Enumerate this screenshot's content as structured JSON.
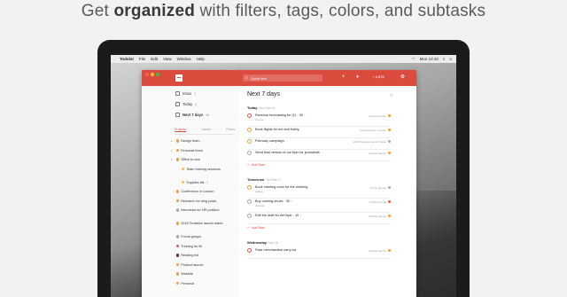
{
  "headline": {
    "pre": "Get ",
    "bold": "organized",
    "post": " with filters, tags, colors, and subtasks"
  },
  "menubar": {
    "app": "Todoist",
    "items": [
      "File",
      "Edit",
      "View",
      "Window",
      "Help"
    ],
    "clock": "Mon 13:10"
  },
  "toolbar": {
    "search_placeholder": "Quick find",
    "karma": "4,876"
  },
  "sidebar": {
    "nav": [
      {
        "label": "Inbox",
        "count": "5"
      },
      {
        "label": "Today",
        "count": "6"
      },
      {
        "label": "Next 7 days",
        "count": "26"
      }
    ],
    "tabs": [
      "Projects",
      "Labels",
      "Filters"
    ],
    "projects": [
      {
        "label": "Design team",
        "count": "",
        "color": "#f0a030",
        "caret": "▸",
        "indent": 0
      },
      {
        "label": "Financial team",
        "count": "",
        "color": "#f0a030",
        "caret": "▸",
        "indent": 0
      },
      {
        "label": "Office to-dos",
        "count": "",
        "color": "#f0a030",
        "caret": "▾",
        "indent": 0
      },
      {
        "label": "Team training sessions",
        "count": "",
        "color": "#f5c242",
        "caret": "",
        "indent": 1
      },
      {
        "label": "Supplies list",
        "count": "5",
        "color": "#f5c242",
        "caret": "",
        "indent": 1
      },
      {
        "label": "Conference in London",
        "count": "",
        "color": "#f0a030",
        "caret": "",
        "indent": 0
      },
      {
        "label": "Research for blog posts",
        "count": "",
        "color": "#f0a030",
        "caret": "",
        "indent": 0
      },
      {
        "label": "Interviews for HR position",
        "count": "",
        "color": "#aaaaaa",
        "caret": "",
        "indent": 0
      },
      {
        "label": "2016 Tentative launch dates",
        "count": "",
        "color": "#f0a030",
        "caret": "",
        "indent": 0
      },
      {
        "label": "Focus groups",
        "count": "",
        "color": "#aaaaaa",
        "caret": "",
        "indent": 0
      },
      {
        "label": "Training for 5k",
        "count": "",
        "color": "#e05a4f",
        "caret": "",
        "indent": 0
      },
      {
        "label": "Reading list",
        "count": "",
        "color": "#8a2a2a",
        "caret": "",
        "indent": 0
      },
      {
        "label": "Product launch",
        "count": "",
        "color": "#f0a030",
        "caret": "",
        "indent": 0
      },
      {
        "label": "Website",
        "count": "",
        "color": "#f0a030",
        "caret": "",
        "indent": 0
      },
      {
        "label": "Personal",
        "count": "",
        "color": "#f0a030",
        "caret": "",
        "indent": 0
      }
    ]
  },
  "main": {
    "title": "Next 7 days",
    "add_task": "Add Task",
    "sections": [
      {
        "name": "Today",
        "sub": "Mon Mar 16",
        "tasks": [
          {
            "text": "Revenue forecasting for Q1 · 30 ◦",
            "label": "finance",
            "project": "Financial team",
            "color": "#f0a030",
            "cb": "#e05a4f"
          },
          {
            "text": "Book flights for me and Kathy",
            "label": "",
            "project": "Conference in London",
            "color": "#f0a030",
            "cb": "#f0a030"
          },
          {
            "text": "February campaign",
            "label": "",
            "project": "2016 Tentative launch dates",
            "color": "#aaaaaa",
            "cb": "#f0a030"
          },
          {
            "text": "Send final version of our flyer for journalists",
            "label": "",
            "project": "Product launch",
            "color": "#f0a030",
            "cb": "#aaaaaa"
          }
        ]
      },
      {
        "name": "Tomorrow",
        "sub": "Tue Mar 17",
        "tasks": [
          {
            "text": "Book meeting room for the meeting",
            "label": "calling",
            "project": "Focus groups",
            "color": "#aaaaaa",
            "cb": "#f0a030"
          },
          {
            "text": "Buy running shoes · 30 ◦",
            "label": "errands",
            "project": "Training for 5k",
            "color": "#e05a4f",
            "cb": "#aaaaaa"
          },
          {
            "text": "Edit the draft for the flyer · 10 ◦",
            "label": "",
            "project": "Product launch",
            "color": "#f0a030",
            "cb": "#aaaaaa"
          }
        ]
      },
      {
        "name": "Wednesday",
        "sub": "Mar 18",
        "tasks": [
          {
            "text": "Pack merchandise carry-on",
            "label": "",
            "project": "Product launch",
            "color": "#f0a030",
            "cb": "#e05a4f"
          }
        ]
      }
    ]
  }
}
